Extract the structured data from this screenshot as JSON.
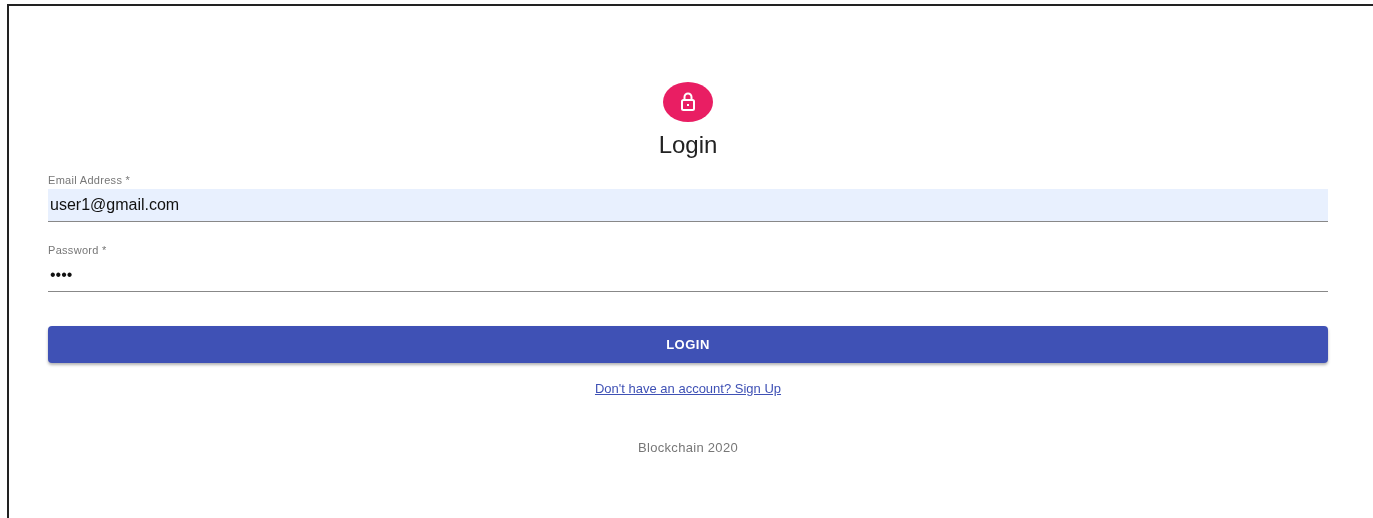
{
  "title": "Login",
  "fields": [
    {
      "label": "Email Address *",
      "value": "user1@gmail.com",
      "autofilled": true
    },
    {
      "label": "Password *",
      "value": "••••",
      "autofilled": false
    }
  ],
  "button": "LOGIN",
  "link": "Don't have an account? Sign Up",
  "footer": "Blockchain 2020"
}
